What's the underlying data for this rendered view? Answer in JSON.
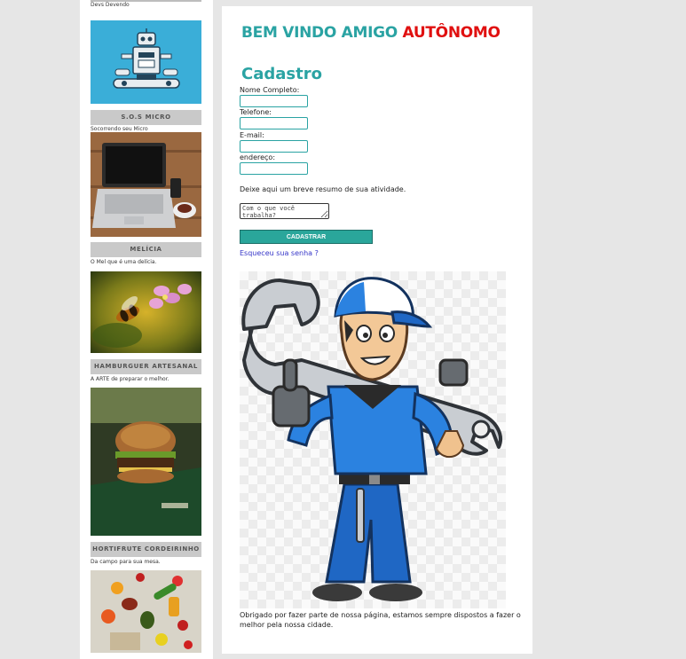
{
  "sidebar": {
    "items": [
      {
        "caption": "Devs Devendo"
      },
      {
        "title": "S.O.S MICRO",
        "caption": "Socorrendo seu Micro"
      },
      {
        "title": "MELÍCIA",
        "caption": "O Mel que é uma delícia."
      },
      {
        "title": "HAMBURGUER ARTESANAL",
        "caption": "A ARTE de preparar o melhor."
      },
      {
        "title": "HORTIFRUTE CORDEIRINHO",
        "caption": "Da campo para sua mesa."
      }
    ]
  },
  "main": {
    "welcome_part1": "BEM VINDO AMIGO",
    "welcome_part2": "AUTÔNOMO",
    "form_title": "Cadastro",
    "fields": [
      {
        "label": "Nome Completo:",
        "value": ""
      },
      {
        "label": "Telefone:",
        "value": ""
      },
      {
        "label": "E-mail:",
        "value": ""
      },
      {
        "label": "endereço:",
        "value": ""
      }
    ],
    "summary_prompt": "Deixe aqui um breve resumo de sua atividade.",
    "summary_placeholder": "Com o que você trabalha?",
    "submit_label": "CADASTRAR",
    "forgot_link": "Esqueceu sua senha ?",
    "thanks_text": "Obrigado por fazer parte de nossa página, estamos sempre dispostos a fazer o melhor pela nossa cidade."
  },
  "colors": {
    "accent": "#2aa3a3",
    "highlight": "#e01010",
    "button": "#2aa69b",
    "link": "#3535c8",
    "page_bg": "#e6e6e6"
  }
}
